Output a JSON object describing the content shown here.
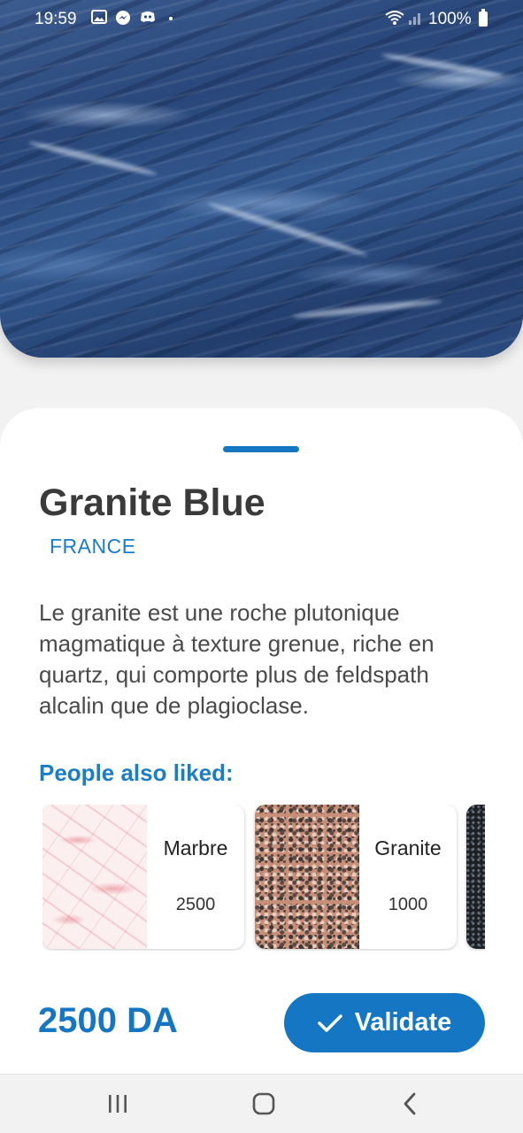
{
  "status_bar": {
    "time": "19:59",
    "notification_icons": [
      "gallery-icon",
      "messenger-icon",
      "discord-icon",
      "dot-icon"
    ],
    "battery": "100%"
  },
  "hero": {
    "image": "granite-blue-stone-texture",
    "colors": [
      "#3c5c8f",
      "#29477a",
      "#223e6d"
    ]
  },
  "product": {
    "name": "Granite Blue",
    "origin": "FRANCE",
    "description": "Le granite est une roche plutonique magmatique à texture grenue, riche en quartz, qui comporte plus de feldspath alcalin que de plagioclase."
  },
  "related": {
    "heading": "People also liked:",
    "items": [
      {
        "name": "Marbre",
        "price": "2500",
        "image": "pink-marble-texture"
      },
      {
        "name": "Granite",
        "price": "1000",
        "image": "rose-granite-texture"
      },
      {
        "name": "",
        "price": "",
        "image": "black-granite-texture"
      }
    ]
  },
  "footer": {
    "price": "2500 DA",
    "validate_label": "Validate"
  },
  "nav": {
    "buttons": [
      "recent-apps-icon",
      "home-icon",
      "back-icon"
    ]
  },
  "theme": {
    "accent": "#1577c4",
    "title_color": "#3a3a3a",
    "text_color": "#4a4a4a"
  }
}
